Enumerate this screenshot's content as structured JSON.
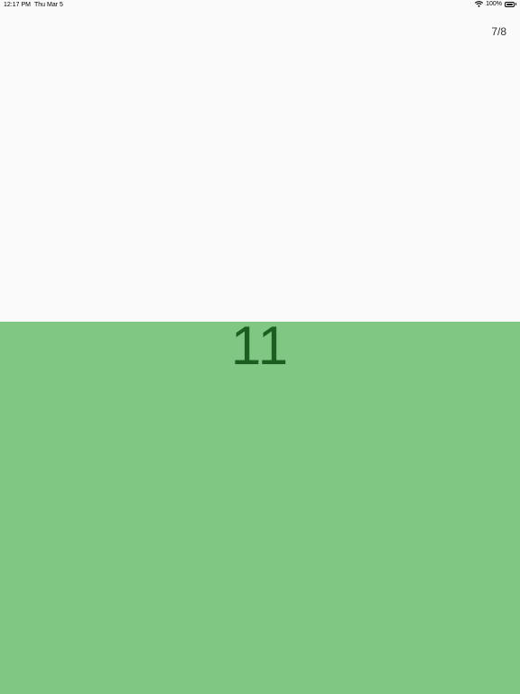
{
  "status_bar": {
    "time": "12:17 PM",
    "date": "Thu Mar 5",
    "battery_percent": "100%",
    "battery_level": 1.0,
    "wifi_icon": "wifi-icon",
    "battery_icon": "battery-icon"
  },
  "pager": {
    "indicator": "7/8"
  },
  "card": {
    "value": "11",
    "background_color": "#81c784",
    "text_color": "#1b5e20",
    "page_background": "#fafafa"
  }
}
